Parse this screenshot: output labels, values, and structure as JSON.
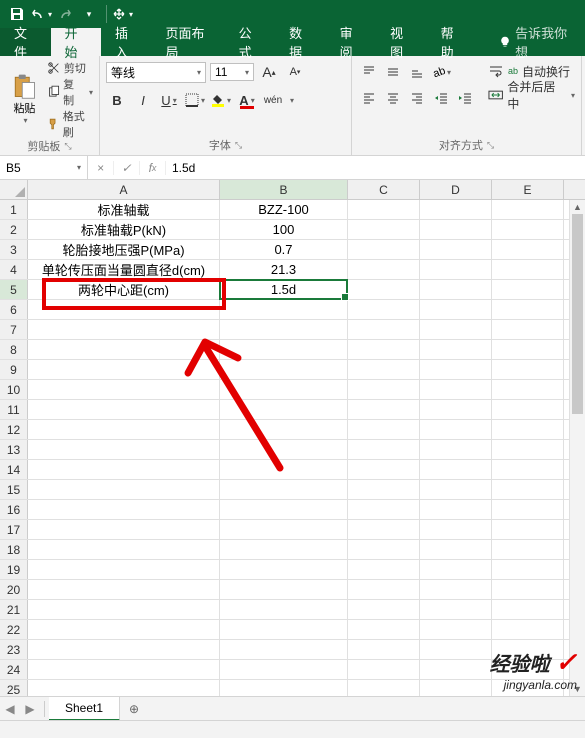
{
  "qat": {
    "save": "save",
    "undo": "undo",
    "redo": "redo"
  },
  "tabs": {
    "file": "文件",
    "home": "开始",
    "insert": "插入",
    "pagelayout": "页面布局",
    "formulas": "公式",
    "data": "数据",
    "review": "审阅",
    "view": "视图",
    "help": "帮助",
    "tellme": "告诉我你想"
  },
  "ribbon": {
    "clipboard": {
      "paste": "粘贴",
      "cut": "剪切",
      "copy": "复制",
      "format_painter": "格式刷",
      "label": "剪贴板"
    },
    "font": {
      "name": "等线",
      "size": "11",
      "grow": "A",
      "shrink": "A",
      "bold": "B",
      "italic": "I",
      "underline": "U",
      "label": "字体"
    },
    "alignment": {
      "wrap": "自动换行",
      "merge": "合并后居中",
      "label": "对齐方式"
    }
  },
  "namebox": {
    "ref": "B5",
    "formula": "1.5d"
  },
  "columns": [
    "A",
    "B",
    "C",
    "D",
    "E"
  ],
  "rows": [
    "1",
    "2",
    "3",
    "4",
    "5",
    "6",
    "7",
    "8",
    "9",
    "10",
    "11",
    "12",
    "13",
    "14",
    "15",
    "16",
    "17",
    "18",
    "19",
    "20",
    "21",
    "22",
    "23",
    "24",
    "25"
  ],
  "cells": {
    "a1": "标准轴载",
    "b1": "BZZ-100",
    "a2": "标准轴载P(kN)",
    "b2": "100",
    "a3": "轮胎接地压强P(MPa)",
    "b3": "0.7",
    "a4": "单轮传压面当量圆直径d(cm)",
    "b4": "21.3",
    "a5": "两轮中心距(cm)",
    "b5": "1.5d"
  },
  "sheets": {
    "sheet1": "Sheet1"
  },
  "watermark": {
    "line1": "经验啦",
    "line2": "jingyanla.com"
  },
  "wen": "wén"
}
